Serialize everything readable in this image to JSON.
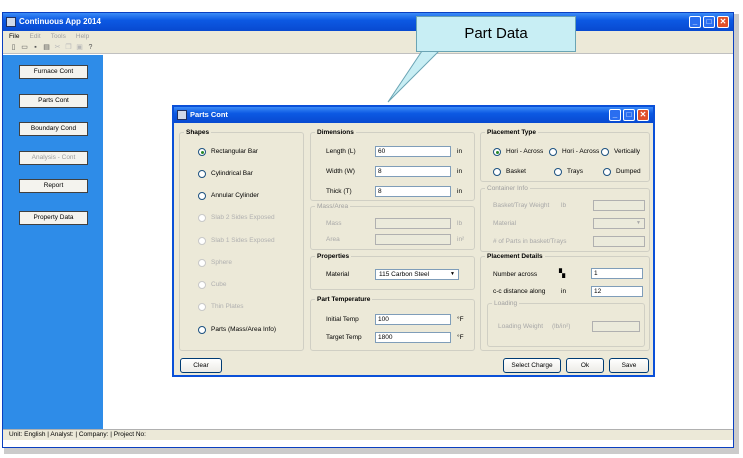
{
  "app": {
    "title": "Continuous App 2014"
  },
  "menu": [
    {
      "label": "File",
      "enabled": true
    },
    {
      "label": "Edit",
      "enabled": false
    },
    {
      "label": "Tools",
      "enabled": false
    },
    {
      "label": "Help",
      "enabled": false
    }
  ],
  "sidebar": {
    "furnace": "Furnace Cont",
    "parts": "Parts Cont",
    "boundary": "Boundary Cond",
    "analysis": "Analysis - Cont",
    "report": "Report",
    "property": "Property Data"
  },
  "status": "Unit: English | Analyst: | Company: | Project No:",
  "callout": "Part Data",
  "dialog": {
    "title": "Parts Cont",
    "shapes": {
      "title": "Shapes",
      "rect": "Rectangular Bar",
      "cyl": "Cylindrical Bar",
      "ann": "Annular Cylinder",
      "slab2": "Slab 2 Sides Exposed",
      "slab1": "Slab 1 Sides Exposed",
      "sphere": "Sphere",
      "cube": "Cube",
      "thin": "Thin Plates",
      "parts": "Parts (Mass/Area Info)"
    },
    "dimensions": {
      "title": "Dimensions",
      "length_label": "Length (L)",
      "length": "60",
      "length_unit": "in",
      "width_label": "Width (W)",
      "width": "8",
      "width_unit": "in",
      "thick_label": "Thick (T)",
      "thick": "8",
      "thick_unit": "in"
    },
    "massarea": {
      "title": "Mass/Area",
      "mass_label": "Mass",
      "mass_unit": "lb",
      "area_label": "Area",
      "area_unit": "in²"
    },
    "properties": {
      "title": "Properties",
      "material_label": "Material",
      "material": "115 Carbon Steel"
    },
    "temperature": {
      "title": "Part Temperature",
      "initial_label": "Initial Temp",
      "initial": "100",
      "initial_unit": "°F",
      "target_label": "Target Temp",
      "target": "1800",
      "target_unit": "°F"
    },
    "placement_type": {
      "title": "Placement Type",
      "hori1": "Hori - Across",
      "hori2": "Hori - Across",
      "vert": "Vertically",
      "basket": "Basket",
      "trays": "Trays",
      "dumped": "Dumped"
    },
    "container": {
      "title": "Container Info",
      "basket_weight_label": "Basket/Tray Weight",
      "basket_weight_unit": "lb",
      "material_label": "Material",
      "nparts_label": "# of Parts in basket/Trays"
    },
    "placement_details": {
      "title": "Placement Details",
      "number_label": "Number across",
      "number": "1",
      "cc_label": "c-c distance along",
      "cc_unit": "in",
      "cc": "12"
    },
    "loading": {
      "title": "Loading",
      "label": "Loading Weight",
      "unit": "(lb/in²)"
    },
    "buttons": {
      "clear": "Clear",
      "select_charge": "Select Charge",
      "ok": "Ok",
      "save": "Save"
    }
  }
}
